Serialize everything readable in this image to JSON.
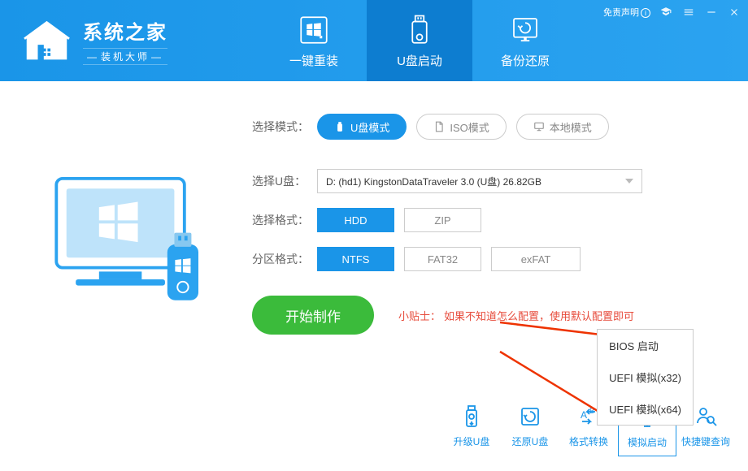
{
  "titlebar": {
    "disclaimer": "免责声明"
  },
  "logo": {
    "title": "系统之家",
    "subtitle": "装机大师"
  },
  "nav": {
    "items": [
      {
        "label": "一键重装"
      },
      {
        "label": "U盘启动"
      },
      {
        "label": "备份还原"
      }
    ]
  },
  "mode": {
    "label": "选择模式：",
    "options": [
      {
        "label": "U盘模式"
      },
      {
        "label": "ISO模式"
      },
      {
        "label": "本地模式"
      }
    ]
  },
  "usb": {
    "label": "选择U盘：",
    "value": "D: (hd1) KingstonDataTraveler 3.0 (U盘) 26.82GB"
  },
  "format": {
    "label": "选择格式：",
    "options": [
      "HDD",
      "ZIP"
    ]
  },
  "partition": {
    "label": "分区格式：",
    "options": [
      "NTFS",
      "FAT32",
      "exFAT"
    ]
  },
  "start": "开始制作",
  "tip": {
    "label": "小贴士：",
    "text": "如果不知道怎么配置，使用默认配置即可"
  },
  "popup": {
    "items": [
      "BIOS 启动",
      "UEFI 模拟(x32)",
      "UEFI 模拟(x64)"
    ]
  },
  "bottom": {
    "items": [
      {
        "label": "升级U盘"
      },
      {
        "label": "还原U盘"
      },
      {
        "label": "格式转换"
      },
      {
        "label": "模拟启动"
      },
      {
        "label": "快捷键查询"
      }
    ]
  }
}
